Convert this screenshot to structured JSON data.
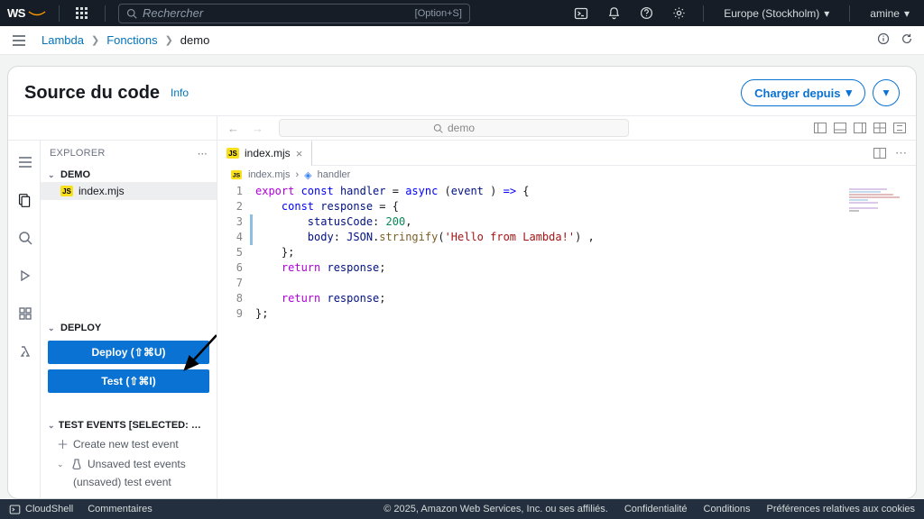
{
  "topbar": {
    "logo_text": "WS",
    "search_placeholder": "Rechercher",
    "search_shortcut": "[Option+S]",
    "region": "Europe (Stockholm)",
    "user": "amine"
  },
  "breadcrumb": {
    "items": [
      "Lambda",
      "Fonctions",
      "demo"
    ]
  },
  "header": {
    "title": "Source du code",
    "info": "Info",
    "upload_label": "Charger depuis"
  },
  "editor_toolbar": {
    "search_text": "demo"
  },
  "explorer": {
    "title": "EXPLORER",
    "project": "DEMO",
    "file": "index.mjs"
  },
  "deploy": {
    "section": "DEPLOY",
    "deploy_label": "Deploy (⇧⌘U)",
    "test_label": "Test (⇧⌘I)"
  },
  "test_events": {
    "section": "TEST EVENTS [SELECTED: (UNSAVED) TEST...",
    "create": "Create new test event",
    "group": "Unsaved test events",
    "item": "(unsaved) test event"
  },
  "tab": {
    "name": "index.mjs"
  },
  "crumb_inner": {
    "file": "index.mjs",
    "symbol": "handler"
  },
  "code": {
    "lines": [
      {
        "n": 1,
        "dirty": false,
        "tokens": [
          [
            "kw-exp",
            "export "
          ],
          [
            "kw",
            "const "
          ],
          [
            "vr",
            "handler"
          ],
          [
            "",
            " = "
          ],
          [
            "kw",
            "async"
          ],
          [
            "",
            " ("
          ],
          [
            "vr",
            "event"
          ],
          [
            "",
            " ) "
          ],
          [
            "kw",
            "=>"
          ],
          [
            "",
            " {"
          ]
        ]
      },
      {
        "n": 2,
        "dirty": false,
        "tokens": [
          [
            "",
            "    "
          ],
          [
            "kw",
            "const "
          ],
          [
            "vr",
            "response"
          ],
          [
            "",
            " = {"
          ]
        ]
      },
      {
        "n": 3,
        "dirty": true,
        "tokens": [
          [
            "",
            "        "
          ],
          [
            "vr",
            "statusCode"
          ],
          [
            "",
            ": "
          ],
          [
            "num",
            "200"
          ],
          [
            "",
            ","
          ]
        ]
      },
      {
        "n": 4,
        "dirty": true,
        "tokens": [
          [
            "",
            "        "
          ],
          [
            "vr",
            "body"
          ],
          [
            "",
            ": "
          ],
          [
            "vr",
            "JSON"
          ],
          [
            "",
            "."
          ],
          [
            "fn",
            "stringify"
          ],
          [
            "",
            "("
          ],
          [
            "str",
            "'Hello from Lambda!'"
          ],
          [
            "",
            ") ,"
          ]
        ]
      },
      {
        "n": 5,
        "dirty": false,
        "tokens": [
          [
            "",
            "    };"
          ]
        ]
      },
      {
        "n": 6,
        "dirty": false,
        "tokens": [
          [
            "",
            "    "
          ],
          [
            "kw-exp",
            "return "
          ],
          [
            "vr",
            "response"
          ],
          [
            "",
            ";"
          ]
        ]
      },
      {
        "n": 7,
        "dirty": false,
        "tokens": [
          [
            "",
            ""
          ]
        ]
      },
      {
        "n": 8,
        "dirty": false,
        "tokens": [
          [
            "",
            "    "
          ],
          [
            "kw-exp",
            "return "
          ],
          [
            "vr",
            "response"
          ],
          [
            "",
            ";"
          ]
        ]
      },
      {
        "n": 9,
        "dirty": false,
        "tokens": [
          [
            "",
            "};"
          ]
        ]
      }
    ]
  },
  "footer": {
    "cloudshell": "CloudShell",
    "comments": "Commentaires",
    "copyright": "© 2025, Amazon Web Services, Inc. ou ses affiliés.",
    "links": [
      "Confidentialité",
      "Conditions",
      "Préférences relatives aux cookies"
    ]
  }
}
